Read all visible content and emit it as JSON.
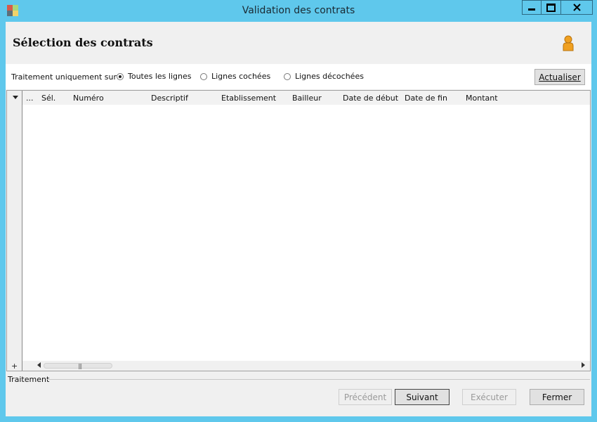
{
  "window": {
    "title": "Validation des contrats"
  },
  "header": {
    "title": "Sélection des contrats"
  },
  "filter": {
    "label": "Traitement uniquement sur :",
    "options": [
      "Toutes les lignes",
      "Lignes cochées",
      "Lignes décochées"
    ],
    "selected": "Toutes les lignes",
    "refresh_label": "Actualiser"
  },
  "grid": {
    "columns": [
      "...",
      "Sél.",
      "Numéro",
      "Descriptif",
      "Etablissement",
      "Bailleur",
      "Date de début",
      "Date de fin",
      "Montant"
    ],
    "rows": [],
    "add_symbol": "+"
  },
  "footer": {
    "group_label": "Traitement",
    "buttons": {
      "previous": "Précédent",
      "next": "Suivant",
      "execute": "Exécuter",
      "close": "Fermer"
    }
  },
  "colors": {
    "titlebar": "#5fc8ec",
    "accent": "#f0a020"
  }
}
